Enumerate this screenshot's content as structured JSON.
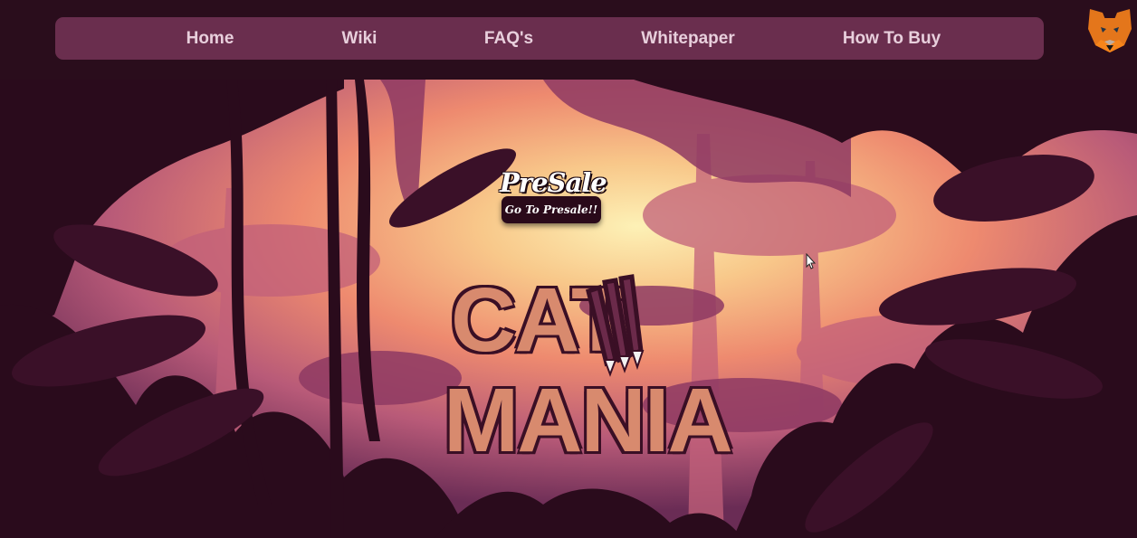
{
  "nav": {
    "items": [
      {
        "label": "Home"
      },
      {
        "label": "Wiki"
      },
      {
        "label": "FAQ's"
      },
      {
        "label": "Whitepaper"
      },
      {
        "label": "How To Buy"
      }
    ]
  },
  "wallet": {
    "icon": "metamask-fox-icon"
  },
  "presale": {
    "title": "PreSale",
    "button_label": "Go To Presale!!"
  },
  "logo": {
    "line1": "CAT",
    "line2": "MANIA"
  },
  "colors": {
    "background": "#2a0d1c",
    "nav_bar": "#6a2e4e",
    "nav_text": "#e8cfdc",
    "sky_light": "#fbe6a6",
    "sky_mid": "#f08a6e",
    "jungle_dark": "#2a0b1c",
    "logo_fill": "#d88a6e"
  }
}
